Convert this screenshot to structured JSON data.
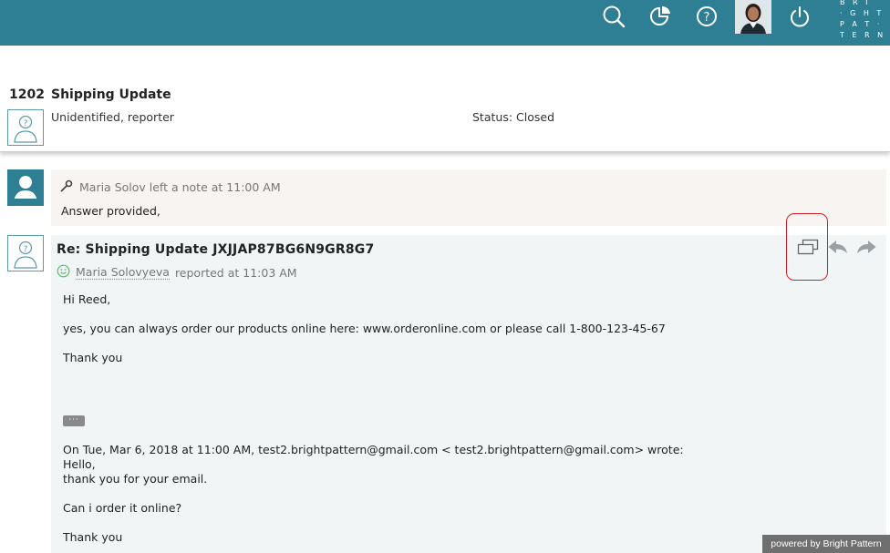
{
  "topbar": {
    "icons": [
      "search-icon",
      "reports-icon",
      "help-icon",
      "user-avatar",
      "power-icon"
    ],
    "logo_lines": [
      "B R I",
      "· G H T",
      "P A T ·",
      "T E R N"
    ],
    "color": "#2e7f93"
  },
  "ticket": {
    "id": "1202",
    "title": "Shipping Update",
    "reporter": "Unidentified, reporter",
    "status_label": "Status:",
    "status_value": "Closed"
  },
  "note": {
    "icon": "wrench-icon",
    "header": "Maria Solov left a note at 11:00 AM",
    "body": "Answer provided,"
  },
  "message": {
    "subject": "Re: Shipping Update JXJJAP87BG6N9GR8G7",
    "author": "Maria Solovyeva",
    "reported": "reported at 11:03 AM",
    "lines": [
      "Hi Reed,",
      "yes, you can always order our products online here: www.orderonline.com or please call 1-800-123-45-67",
      "Thank you",
      "On Tue, Mar 6, 2018 at 11:00 AM, test2.brightpattern@gmail.com < test2.brightpattern@gmail.com> wrote:",
      "Hello,",
      "thank you for your email.",
      "Can i order it online?",
      "Thank you"
    ],
    "ellipsis": "···",
    "actions": [
      "open-window-icon",
      "reply-icon",
      "forward-icon"
    ]
  },
  "footer": {
    "powered_by": "powered by Bright Pattern"
  },
  "colors": {
    "accent": "#2e7f93",
    "highlight": "#d0202a",
    "note_bg": "#f8f4f1",
    "message_bg": "#f1f5f6"
  }
}
